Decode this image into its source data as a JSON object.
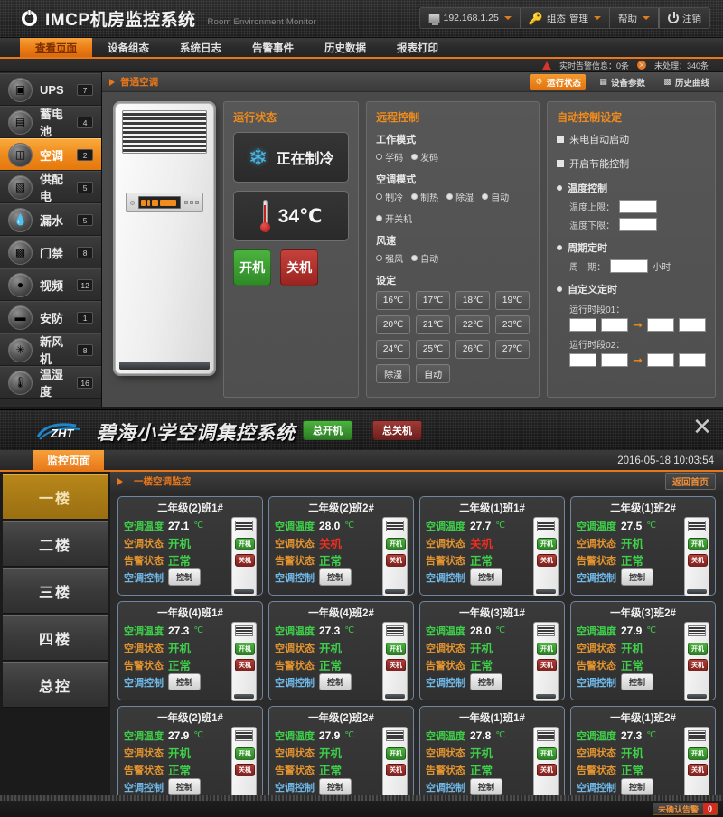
{
  "app1": {
    "brand": {
      "title": "IMCP机房监控系统",
      "subtitle": "Room Environment Monitor"
    },
    "toolbar": {
      "ip": "192.168.1.25",
      "config": "组态",
      "manage": "管理",
      "help": "帮助",
      "logout": "注销"
    },
    "status": {
      "realtime_alarm": "实时告警信息：0条",
      "unhandled": "未处理：340条"
    },
    "nav": [
      {
        "label": "查看页面",
        "active": true
      },
      {
        "label": "设备组态",
        "active": false
      },
      {
        "label": "系统日志",
        "active": false
      },
      {
        "label": "告警事件",
        "active": false
      },
      {
        "label": "历史数据",
        "active": false
      },
      {
        "label": "报表打印",
        "active": false
      }
    ],
    "sidebar": [
      {
        "label": "UPS",
        "count": "7",
        "icon": "ups-icon",
        "active": false
      },
      {
        "label": "蓄电池",
        "count": "4",
        "icon": "battery-icon",
        "active": false
      },
      {
        "label": "空调",
        "count": "2",
        "icon": "air-conditioner-icon",
        "active": true
      },
      {
        "label": "供配电",
        "count": "5",
        "icon": "power-distribution-icon",
        "active": false
      },
      {
        "label": "漏水",
        "count": "5",
        "icon": "water-leak-icon",
        "active": false
      },
      {
        "label": "门禁",
        "count": "8",
        "icon": "access-control-icon",
        "active": false
      },
      {
        "label": "视频",
        "count": "12",
        "icon": "camera-icon",
        "active": false
      },
      {
        "label": "安防",
        "count": "1",
        "icon": "security-icon",
        "active": false
      },
      {
        "label": "新风机",
        "count": "8",
        "icon": "fan-icon",
        "active": false
      },
      {
        "label": "温湿度",
        "count": "16",
        "icon": "thermo-hygro-icon",
        "active": false
      }
    ],
    "breadcrumb": "普通空调",
    "view_tabs": [
      {
        "label": "运行状态",
        "active": true
      },
      {
        "label": "设备参数",
        "active": false
      },
      {
        "label": "历史曲线",
        "active": false
      }
    ],
    "run_status": {
      "title": "运行状态",
      "mode_text": "正在制冷",
      "temperature": "34℃",
      "power_on": "开机",
      "power_off": "关机"
    },
    "remote": {
      "title": "远程控制",
      "work_mode_label": "工作模式",
      "work_modes": [
        {
          "label": "学码",
          "selected": false
        },
        {
          "label": "发码",
          "selected": true
        }
      ],
      "ac_mode_label": "空调模式",
      "ac_modes": [
        {
          "label": "制冷",
          "selected": false
        },
        {
          "label": "制热",
          "selected": true
        },
        {
          "label": "除湿",
          "selected": true
        },
        {
          "label": "自动",
          "selected": true
        },
        {
          "label": "开关机",
          "selected": true
        }
      ],
      "fan_label": "风速",
      "fan_speeds": [
        {
          "label": "强风",
          "selected": false
        },
        {
          "label": "自动",
          "selected": true
        }
      ],
      "set_label": "设定",
      "temp_buttons": [
        "16℃",
        "17℃",
        "18℃",
        "19℃",
        "20℃",
        "21℃",
        "22℃",
        "23℃",
        "24℃",
        "25℃",
        "26℃",
        "27℃"
      ],
      "extra_buttons": [
        "除湿",
        "自动"
      ]
    },
    "auto": {
      "title": "自动控制设定",
      "power_restore": "来电自动启动",
      "energy_saving": "开启节能控制",
      "temp_control": "温度控制",
      "temp_upper_label": "温度上限：",
      "temp_upper_value": "",
      "temp_lower_label": "温度下限：",
      "temp_lower_value": "",
      "cycle_timer": "周期定时",
      "cycle_label": "周　期：",
      "cycle_value": "",
      "cycle_unit": "小时",
      "custom_timer": "自定义定时",
      "period1_label": "运行时段01：",
      "period2_label": "运行时段02：",
      "period_values": [
        "",
        "",
        "",
        "",
        ""
      ]
    }
  },
  "app2": {
    "title": "碧海小学空调集控系统",
    "logo_text": "ZHT",
    "master_on": "总开机",
    "master_off": "总关机",
    "tab": "监控页面",
    "datetime": "2016-05-18 10:03:54",
    "floors": [
      {
        "label": "一楼",
        "active": true
      },
      {
        "label": "二楼",
        "active": false
      },
      {
        "label": "三楼",
        "active": false
      },
      {
        "label": "四楼",
        "active": false
      },
      {
        "label": "总控",
        "active": false
      }
    ],
    "breadcrumb": "一楼空调监控",
    "home_link": "返回首页",
    "labels": {
      "temp": "空调温度",
      "state": "空调状态",
      "alarm": "告警状态",
      "control": "空调控制",
      "control_button": "控制",
      "unit": "℃",
      "power_on": "开机",
      "power_off": "关机"
    },
    "cards": [
      {
        "title": "二年级(2)班1#",
        "temp": "27.1",
        "state": "开机",
        "state_on": true,
        "alarm": "正常"
      },
      {
        "title": "二年级(2)班2#",
        "temp": "28.0",
        "state": "关机",
        "state_on": false,
        "alarm": "正常"
      },
      {
        "title": "二年级(1)班1#",
        "temp": "27.7",
        "state": "关机",
        "state_on": false,
        "alarm": "正常"
      },
      {
        "title": "二年级(1)班2#",
        "temp": "27.5",
        "state": "开机",
        "state_on": true,
        "alarm": "正常"
      },
      {
        "title": "一年级(4)班1#",
        "temp": "27.3",
        "state": "开机",
        "state_on": true,
        "alarm": "正常"
      },
      {
        "title": "一年级(4)班2#",
        "temp": "27.3",
        "state": "开机",
        "state_on": true,
        "alarm": "正常"
      },
      {
        "title": "一年级(3)班1#",
        "temp": "28.0",
        "state": "开机",
        "state_on": true,
        "alarm": "正常"
      },
      {
        "title": "一年级(3)班2#",
        "temp": "27.9",
        "state": "开机",
        "state_on": true,
        "alarm": "正常"
      },
      {
        "title": "一年级(2)班1#",
        "temp": "27.9",
        "state": "开机",
        "state_on": true,
        "alarm": "正常"
      },
      {
        "title": "一年级(2)班2#",
        "temp": "27.9",
        "state": "开机",
        "state_on": true,
        "alarm": "正常"
      },
      {
        "title": "一年级(1)班1#",
        "temp": "27.8",
        "state": "开机",
        "state_on": true,
        "alarm": "正常"
      },
      {
        "title": "一年级(1)班2#",
        "temp": "27.3",
        "state": "开机",
        "state_on": true,
        "alarm": "正常"
      }
    ],
    "footer": {
      "alarm_label": "未确认告警",
      "alarm_count": "0"
    }
  },
  "colors": {
    "accent": "#e8761a",
    "green": "#3fd04a",
    "red": "#f02d20",
    "blue": "#6fb8e8",
    "gold": "#b8861a"
  }
}
